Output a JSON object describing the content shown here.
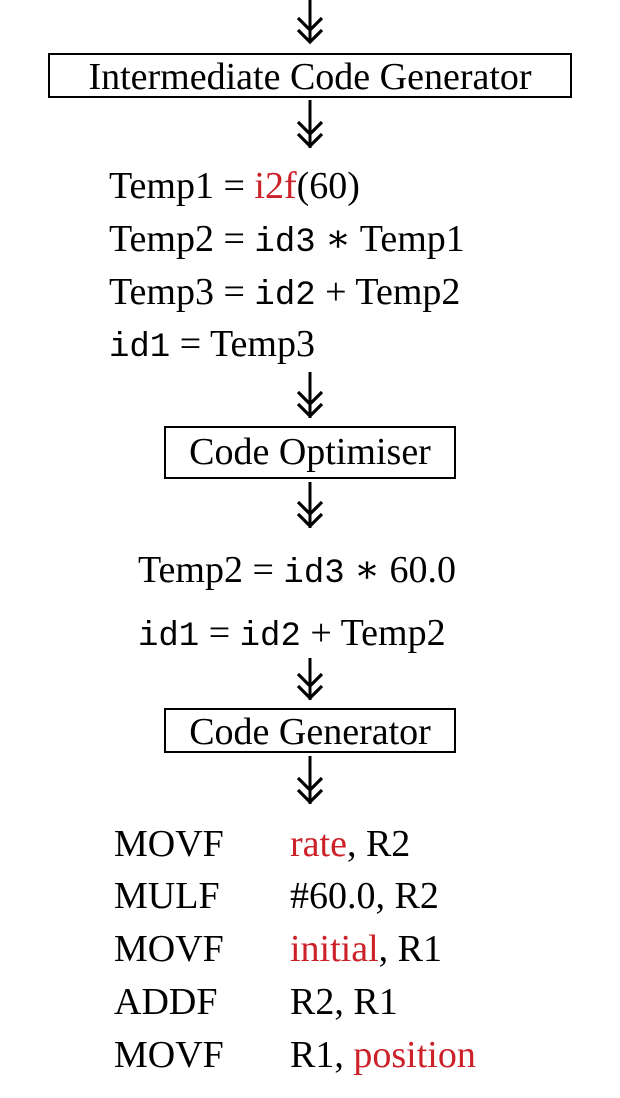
{
  "stages": {
    "icg": "Intermediate Code Generator",
    "optimiser": "Code Optimiser",
    "codegen": "Code Generator"
  },
  "intermediate": {
    "l1_lhs": "Temp1",
    "l1_fn": "i2f",
    "l1_arg": "(60)",
    "l2_lhs": "Temp2",
    "l2_id": "id3",
    "l2_rhs": "Temp1",
    "l3_lhs": "Temp3",
    "l3_id": "id2",
    "l3_rhs": "Temp2",
    "l4_id": "id1",
    "l4_rhs": "Temp3"
  },
  "optimised": {
    "l1_lhs": "Temp2",
    "l1_id": "id3",
    "l1_val": "60.0",
    "l2_id1": "id1",
    "l2_id2": "id2",
    "l2_rhs": "Temp2"
  },
  "assembly": {
    "r1_op": "MOVF",
    "r1_a": "rate",
    "r1_b": ", R2",
    "r2_op": "MULF",
    "r2_a": "#60.0, R2",
    "r3_op": "MOVF",
    "r3_a": "initial",
    "r3_b": ", R1",
    "r4_op": "ADDF",
    "r4_a": "R2, R1",
    "r5_op": "MOVF",
    "r5_a": "R1, ",
    "r5_b": "position"
  },
  "symbols": {
    "eq": " = ",
    "mul": " ∗ ",
    "plus": " + "
  },
  "colors": {
    "highlight": "#cc2128",
    "text": "#000000"
  },
  "icons": [
    "double-head-arrow-icon"
  ]
}
